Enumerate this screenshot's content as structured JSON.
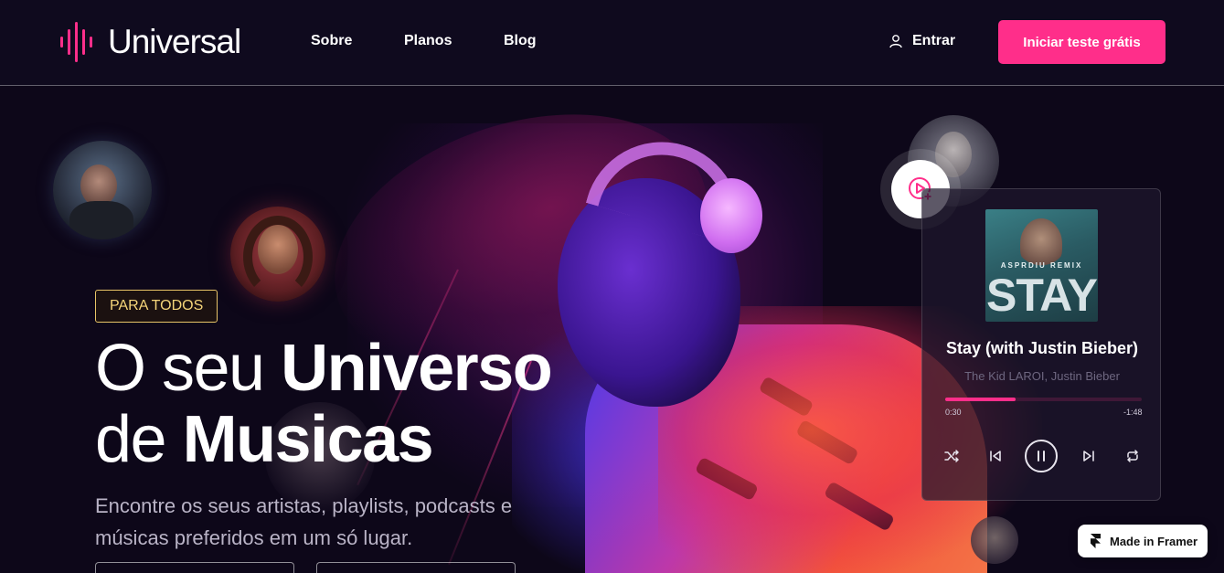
{
  "header": {
    "logo_text": "Universal",
    "nav": [
      {
        "label": "Sobre"
      },
      {
        "label": "Planos"
      },
      {
        "label": "Blog"
      }
    ],
    "login_label": "Entrar",
    "cta_label": "Iniciar teste grátis"
  },
  "hero": {
    "badge": "PARA TODOS",
    "headline_light_1": "O seu ",
    "headline_bold_1": "Universo",
    "headline_light_2": "de ",
    "headline_bold_2": "Musicas",
    "subtitle": "Encontre os seus artistas, playlists, podcasts e músicas preferidos em um só lugar."
  },
  "player": {
    "cover_remix": "ASPRDIU REMIX",
    "cover_title": "STAY",
    "song_title": "Stay (with Justin Bieber)",
    "artist": "The Kid LAROI, Justin Bieber",
    "current_time": "0:30",
    "remaining_time": "-1:48",
    "progress": 0.36
  },
  "colors": {
    "accent": "#ff2e8a",
    "badge": "#e8c467",
    "background": "#0d0719"
  },
  "framer_badge": "Made in Framer"
}
